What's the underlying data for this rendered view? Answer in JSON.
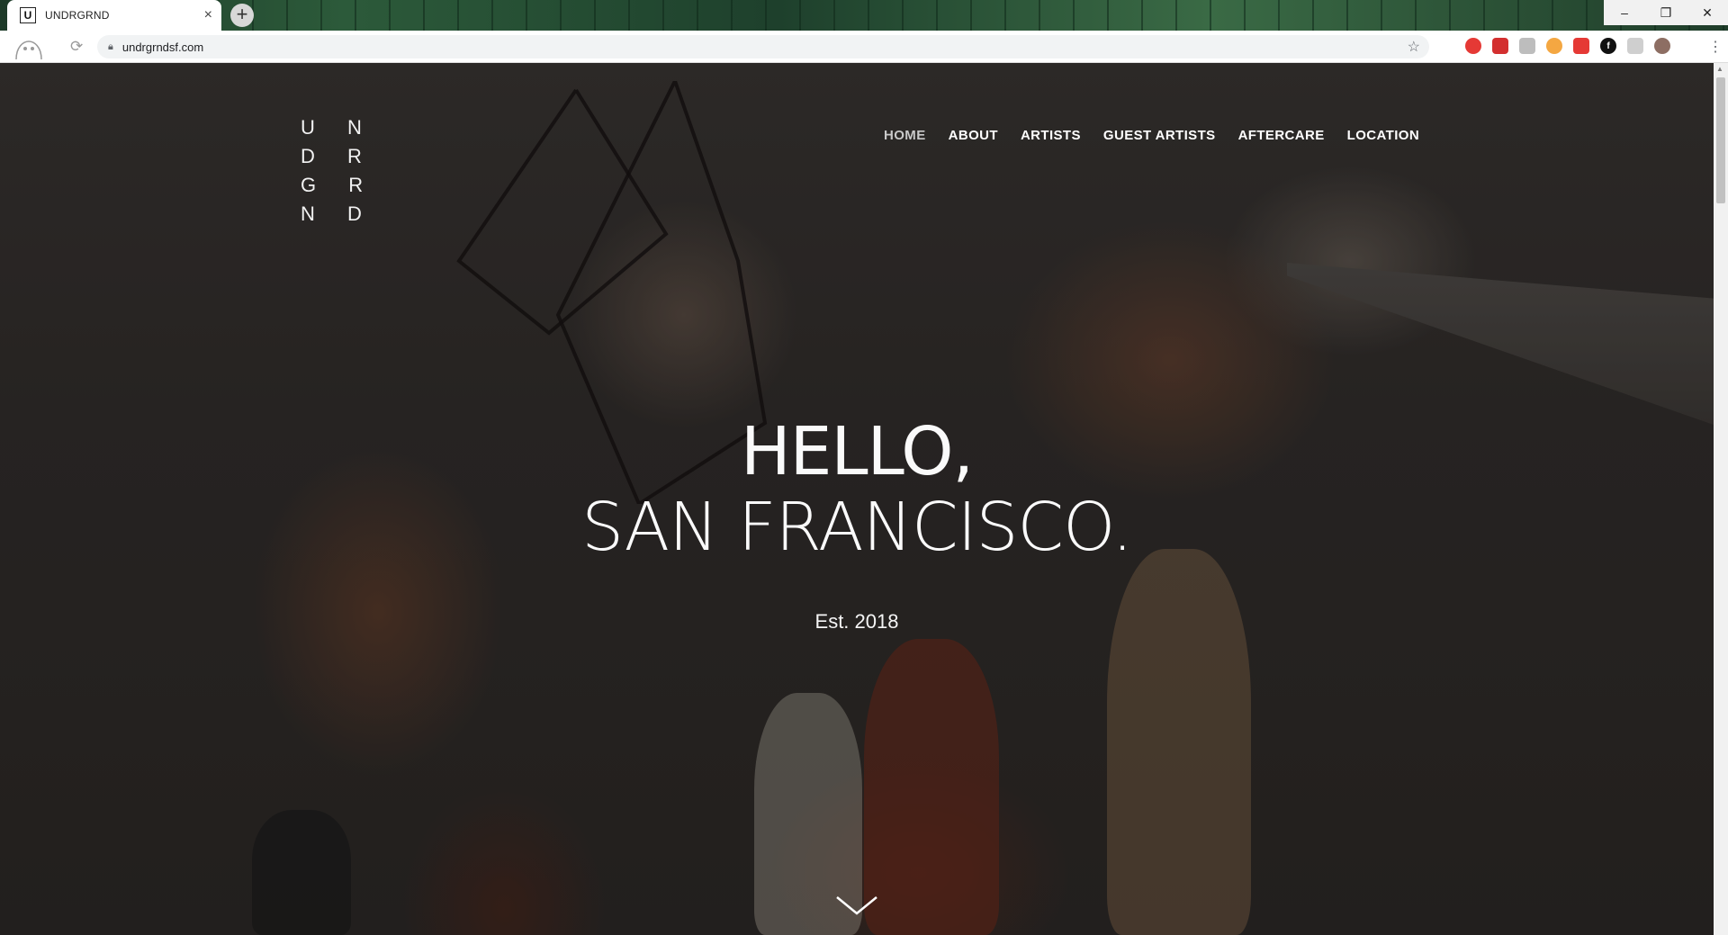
{
  "browser": {
    "tab_title": "UNDRGRND",
    "tab_favicon": "U",
    "tab_close": "×",
    "new_tab": "+",
    "url": "undrgrndsf.com",
    "window_controls": [
      "–",
      "❐",
      "✕"
    ]
  },
  "site": {
    "logo_line1": "U N D R",
    "logo_line2": "G R N D",
    "nav": [
      {
        "label": "HOME",
        "active": true
      },
      {
        "label": "ABOUT"
      },
      {
        "label": "ARTISTS"
      },
      {
        "label": "GUEST ARTISTS"
      },
      {
        "label": "AFTERCARE"
      },
      {
        "label": "LOCATION"
      }
    ],
    "hero_line1": "HELLO,",
    "hero_line2": "SAN FRANCISCO.",
    "established": "Est. 2018"
  },
  "icons": {
    "lock": "lock-icon",
    "star": "star-icon",
    "scroll": "chevron-down-icon"
  }
}
